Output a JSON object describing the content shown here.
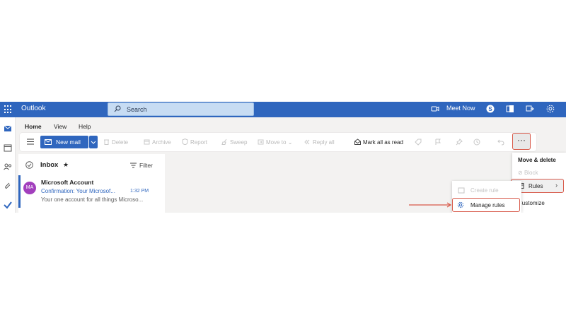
{
  "app": {
    "title": "Outlook"
  },
  "header": {
    "search_placeholder": "Search",
    "meet_now_label": "Meet Now"
  },
  "ribbon": {
    "tabs": [
      "Home",
      "View",
      "Help"
    ],
    "new_mail_label": "New mail",
    "items": {
      "delete": "Delete",
      "archive": "Archive",
      "report": "Report",
      "sweep": "Sweep",
      "move_to": "Move to",
      "reply_all": "Reply all",
      "mark_all_read": "Mark all as read"
    },
    "more_label": "···"
  },
  "message_list": {
    "folder_title": "Inbox",
    "filter_label": "Filter",
    "messages": [
      {
        "avatar_initials": "MA",
        "avatar_color": "#a23fbd",
        "from": "Microsoft Account",
        "subject": "Confirmation: Your Microsof...",
        "time": "1:32 PM",
        "preview": "Your one account for all things Microso..."
      }
    ]
  },
  "more_menu": {
    "header": "Move & delete",
    "block": "Block",
    "rules": "Rules",
    "customize": "Customize"
  },
  "rules_submenu": {
    "create_rule": "Create rule",
    "manage_rules": "Manage rules"
  },
  "colors": {
    "brand": "#2f66be",
    "highlight": "#d85a4a"
  }
}
